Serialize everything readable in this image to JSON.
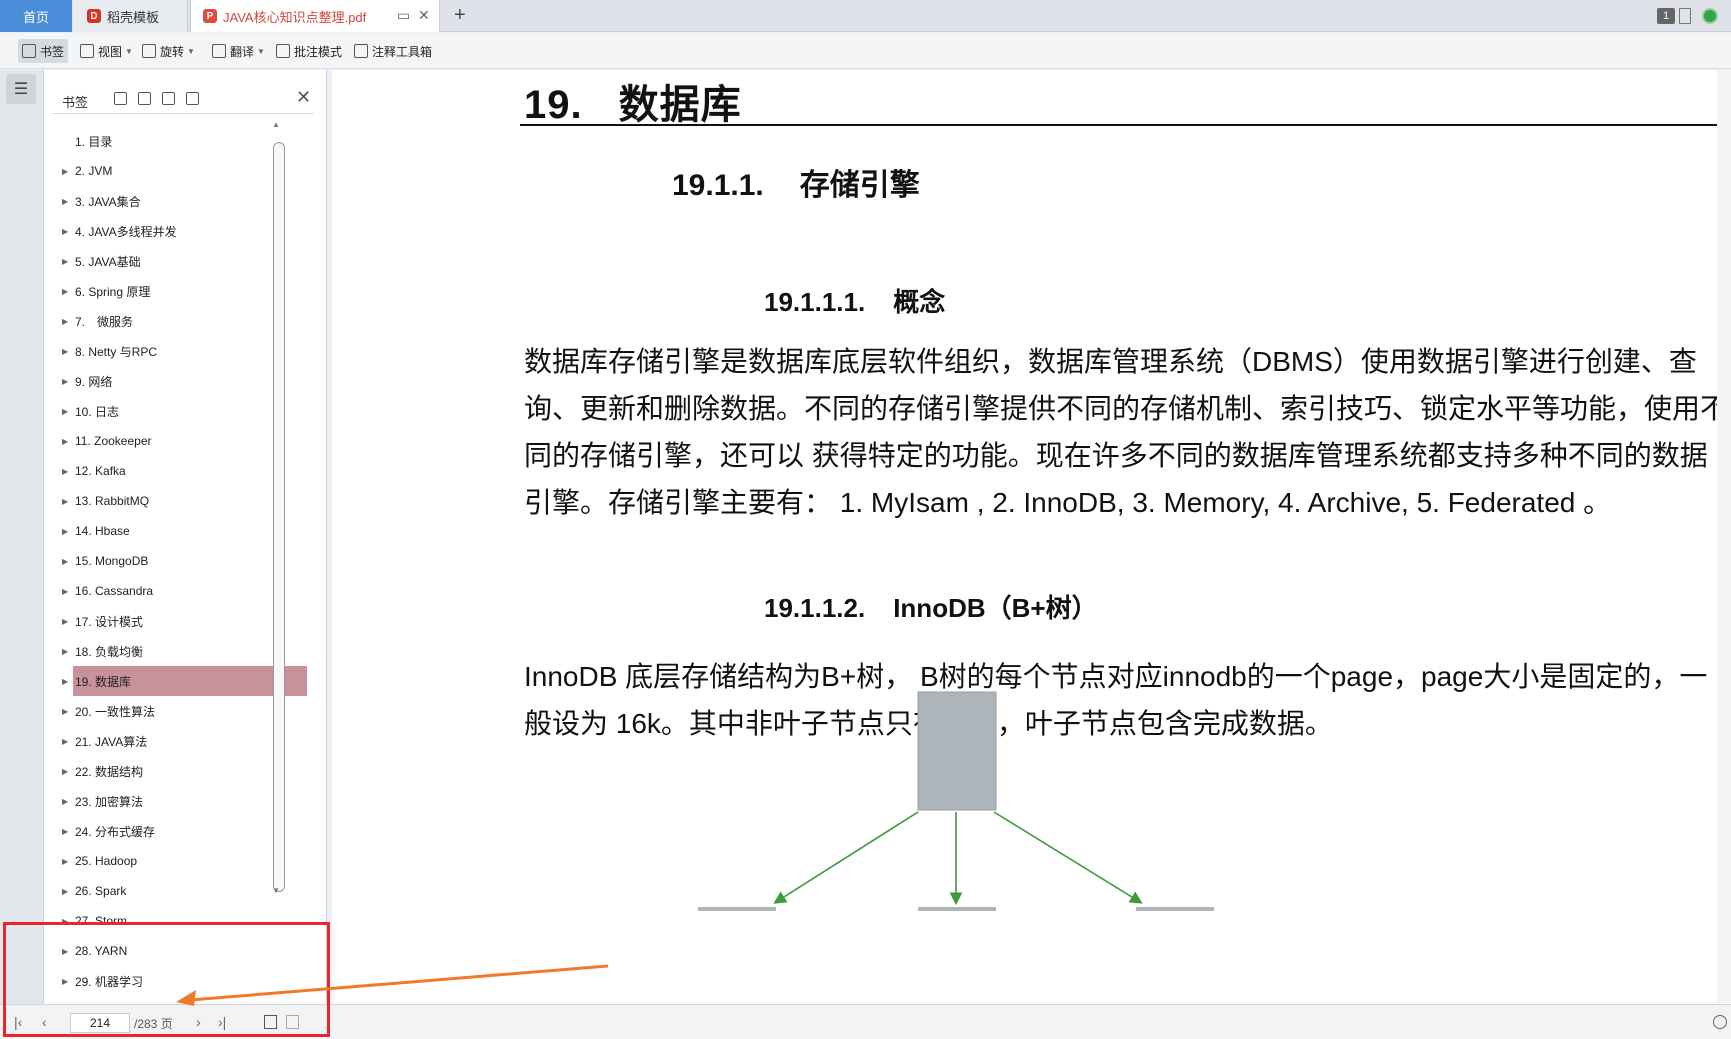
{
  "tabs": {
    "home": "首页",
    "templates": "稻壳模板",
    "document": "JAVA核心知识点整理.pdf"
  },
  "window": {
    "page_badge": "1"
  },
  "toolbar": {
    "bookmark": "书签",
    "view": "视图",
    "rotate": "旋转",
    "translate": "翻译",
    "annotate_mode": "批注模式",
    "annotation_tools": "注释工具箱"
  },
  "bookmarks": {
    "title": "书签",
    "items": [
      {
        "label": "1. 目录",
        "has_children": false
      },
      {
        "label": "2. JVM",
        "has_children": true
      },
      {
        "label": "3. JAVA集合",
        "has_children": true
      },
      {
        "label": "4. JAVA多线程并发",
        "has_children": true
      },
      {
        "label": "5. JAVA基础",
        "has_children": true
      },
      {
        "label": "6. Spring 原理",
        "has_children": true
      },
      {
        "label": "7.　微服务",
        "has_children": true
      },
      {
        "label": "8. Netty 与RPC",
        "has_children": true
      },
      {
        "label": "9. 网络",
        "has_children": true
      },
      {
        "label": "10. 日志",
        "has_children": true
      },
      {
        "label": "11. Zookeeper",
        "has_children": true
      },
      {
        "label": "12. Kafka",
        "has_children": true
      },
      {
        "label": "13. RabbitMQ",
        "has_children": true
      },
      {
        "label": "14. Hbase",
        "has_children": true
      },
      {
        "label": "15. MongoDB",
        "has_children": true
      },
      {
        "label": "16. Cassandra",
        "has_children": true
      },
      {
        "label": "17. 设计模式",
        "has_children": true
      },
      {
        "label": "18. 负载均衡",
        "has_children": true
      },
      {
        "label": "19. 数据库",
        "has_children": true,
        "active": true
      },
      {
        "label": "20. 一致性算法",
        "has_children": true
      },
      {
        "label": "21. JAVA算法",
        "has_children": true
      },
      {
        "label": "22. 数据结构",
        "has_children": true
      },
      {
        "label": "23. 加密算法",
        "has_children": true
      },
      {
        "label": "24. 分布式缓存",
        "has_children": true
      },
      {
        "label": "25. Hadoop",
        "has_children": true
      },
      {
        "label": "26. Spark",
        "has_children": true
      },
      {
        "label": "27. Storm",
        "has_children": true
      },
      {
        "label": "28. YARN",
        "has_children": true
      },
      {
        "label": "29. 机器学习",
        "has_children": true
      }
    ]
  },
  "page_nav": {
    "current_page": "214",
    "total": "/283 页"
  },
  "document": {
    "chapter_num": "19.",
    "chapter_title": "数据库",
    "section_num": "19.1.1.",
    "section_title": "存储引擎",
    "sub1_num": "19.1.1.1.",
    "sub1_title": "概念",
    "para1": "数据库存储引擎是数据库底层软件组织，数据库管理系统（DBMS）使用数据引擎进行创建、查询、更新和删除数据。不同的存储引擎提供不同的存储机制、索引技巧、锁定水平等功能，使用不同的存储引擎，还可以 获得特定的功能。现在许多不同的数据库管理系统都支持多种不同的数据引擎。存储引擎主要有： 1. MyIsam , 2. InnoDB, 3. Memory, 4. Archive, 5. Federated 。",
    "sub2_num": "19.1.1.2.",
    "sub2_title": "InnoDB（B+树）",
    "para2": "InnoDB 底层存储结构为B+树， B树的每个节点对应innodb的一个page，page大小是固定的，一般设为 16k。其中非叶子节点只有键值，叶子节点包含完成数据。"
  },
  "colors": {
    "highlight_box": "#e8262d",
    "pointer_arrow": "#f07a2a",
    "active_bookmark": "#c9919b",
    "tree_node": "#adb5bb",
    "tree_edge": "#3d9a3d",
    "home_tab": "#4a8ed9"
  }
}
